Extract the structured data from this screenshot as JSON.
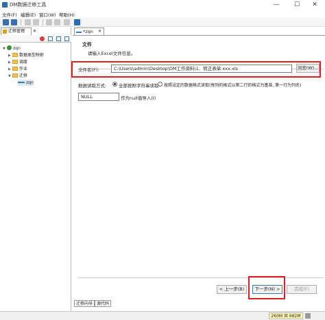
{
  "window": {
    "title": "DM数据迁移工具",
    "minimize": "—",
    "maximize": "☐",
    "close": "✕"
  },
  "menu": [
    "文件(F)",
    "编辑(E)",
    "窗口(W)",
    "帮助(H)"
  ],
  "left_panel": {
    "tab_label": "迁移管理",
    "tab_close": "✕",
    "tree": {
      "root": "zqn",
      "children": [
        "数据类型映射",
        "调度",
        "作业",
        "迁移"
      ],
      "migration_item": "zqn"
    }
  },
  "editor": {
    "tab_label": "*zqn",
    "tab_close": "✕",
    "section_title": "文件",
    "section_desc": "请输入Excel文件信息。",
    "file_label": "文件名(F):",
    "file_value": "C:\\Users\\admin\\Desktop\\DM工作资料\\1、转正表单.xxx.xls",
    "browse_label": "浏览(W)...",
    "read_mode_label": "数据读取方式:",
    "read_mode_options": [
      {
        "label": "全部按照字符串读取",
        "selected": true
      },
      {
        "label": "按照设定的数据格式读取(每列的格式以第二行的格式为基准, 第一行为列名)",
        "selected": false
      }
    ],
    "null_value": "NULL",
    "null_label": "作为null值导入(I)",
    "back_label": "< 上一步(B)",
    "next_label": "下一步(N) >",
    "finish_label": "完成(F)",
    "bottom_tabs": [
      "迁移向导",
      "源代码"
    ]
  },
  "status": {
    "memory": "260M 共 662M"
  },
  "colors": {
    "highlight_box": "#e02020",
    "memory_bg": "#fff5b0"
  },
  "icons": [
    "save-icon",
    "save-all-icon",
    "home-icon",
    "folder-icon",
    "database-icon",
    "migration-icon",
    "trash-icon"
  ]
}
